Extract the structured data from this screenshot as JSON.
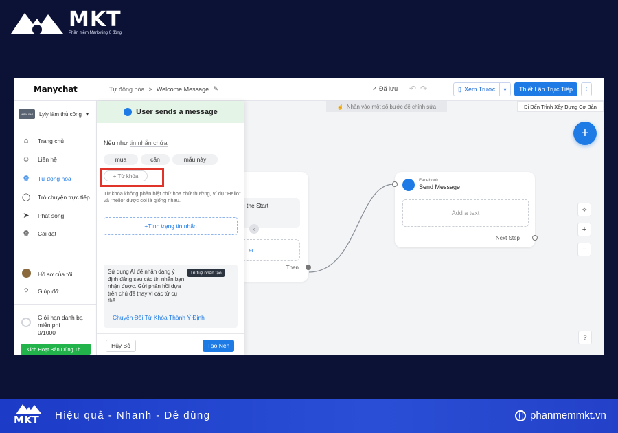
{
  "brand": {
    "name": "MKT",
    "tagline": "Phần mềm Marketing 0 đồng"
  },
  "app": {
    "logo": "Manychat",
    "breadcrumb": {
      "parent": "Tự động hóa",
      "sep": ">",
      "current": "Welcome Message"
    },
    "saved": "✓ Đã lưu",
    "preview_label": "Xem Trước",
    "go_live_label": "Thiết Lập Trực Tiếp",
    "hint": "Nhấn vào một số bước để chỉnh sửa",
    "guide_label": "Đi Đến Trình Xây Dựng Cơ Bản"
  },
  "sidebar": {
    "account_badge": "MIỄN PHÍ",
    "account_name": "Lyly làm thủ công",
    "items": [
      {
        "label": "Trang chủ",
        "icon": "home-icon"
      },
      {
        "label": "Liên hệ",
        "icon": "user-icon"
      },
      {
        "label": "Tự động hóa",
        "icon": "automation-icon",
        "active": true
      },
      {
        "label": "Trò chuyện trực tiếp",
        "icon": "chat-icon"
      },
      {
        "label": "Phát sóng",
        "icon": "send-icon"
      },
      {
        "label": "Cài đặt",
        "icon": "gear-icon"
      }
    ],
    "profile": "Hồ sơ của tôi",
    "help": "Giúp đỡ",
    "limit_line1": "Giới hạn danh bạ",
    "limit_line2": "miễn phí",
    "limit_count": "0/1000",
    "activate": "Kích Hoạt Bản Dùng Th..."
  },
  "panel": {
    "title": "User sends a message",
    "condition_prefix": "Nếu như",
    "condition_value": "tin nhắn chứa",
    "keywords": [
      "mua",
      "cần",
      "mẫu này"
    ],
    "add_keyword": "+ Từ khóa",
    "note": "Từ khóa không phân biệt chữ hoa chữ thường, ví dụ \"Hello\" và \"hello\" được coi là giống nhau.",
    "message_status": "+Tình trạng tin nhắn",
    "ai_text": "Sử dụng AI để nhận dạng ý định đằng sau các tin nhắn bạn nhận được. Gửi phản hồi dựa trên chủ đề thay vì các từ cụ thể.",
    "ai_badge": "Trí tuệ nhân tạo",
    "ai_link": "Chuyển Đổi Từ Khóa Thành Ý Định",
    "cancel": "Hủy Bỏ",
    "create": "Tạo Nên"
  },
  "canvas": {
    "start_text": "king the Start",
    "start_link": "er",
    "then": "Then",
    "send_source": "Facebook",
    "send_title": "Send Message",
    "add_text": "Add a text",
    "next_step": "Next Step"
  },
  "footer": {
    "logo": "MKT",
    "slogan": "Hiệu quả - Nhanh  - Dễ dùng",
    "site": "phanmemmkt.vn"
  }
}
